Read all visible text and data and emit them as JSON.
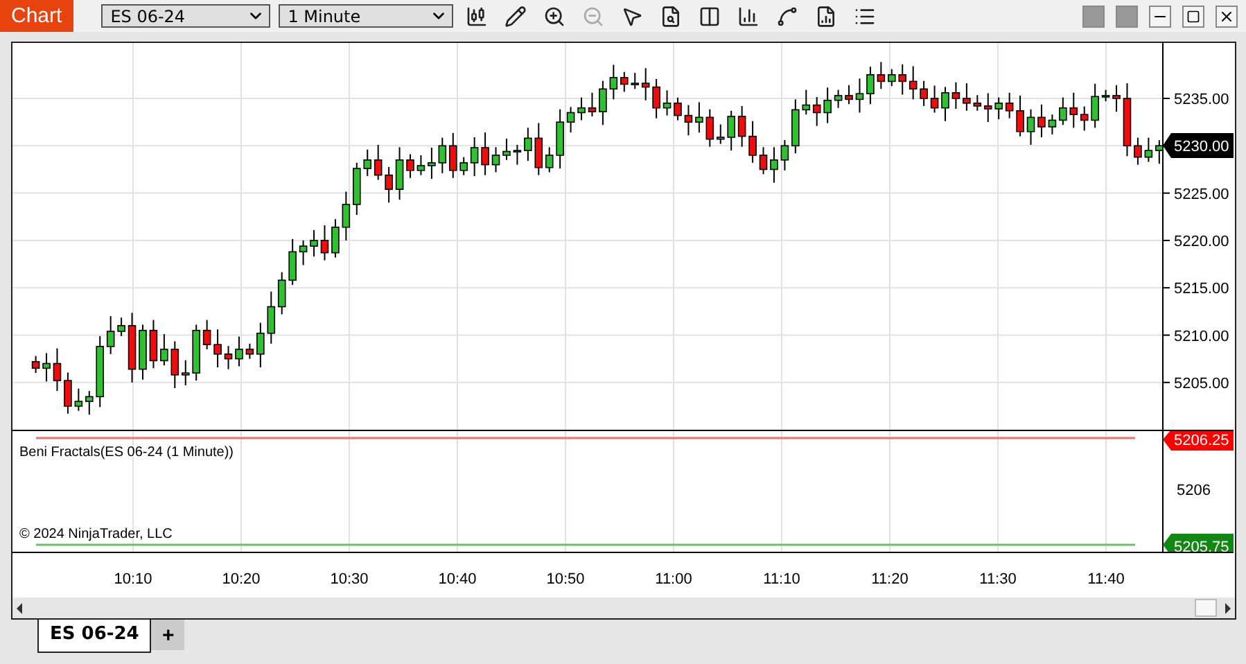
{
  "toolbar": {
    "title": "Chart",
    "instrument": "ES 06-24",
    "interval": "1 Minute"
  },
  "price_panel": {
    "y_labels": [
      "5235.00",
      "5225.00",
      "5220.00",
      "5215.00",
      "5210.00",
      "5205.00"
    ],
    "current_price": "5230.00"
  },
  "indicator_panel": {
    "name": "Beni Fractals(ES 06-24 (1 Minute))",
    "copyright": "© 2024 NinjaTrader, LLC",
    "upper_level": "5206.25",
    "axis_label": "5206",
    "lower_level": "5205.75"
  },
  "time_axis": [
    "10:10",
    "10:20",
    "10:30",
    "10:40",
    "10:50",
    "11:00",
    "11:10",
    "11:20",
    "11:30",
    "11:40"
  ],
  "tabs": [
    {
      "label": "ES 06-24",
      "selected": true
    }
  ],
  "add_tab": "+"
}
